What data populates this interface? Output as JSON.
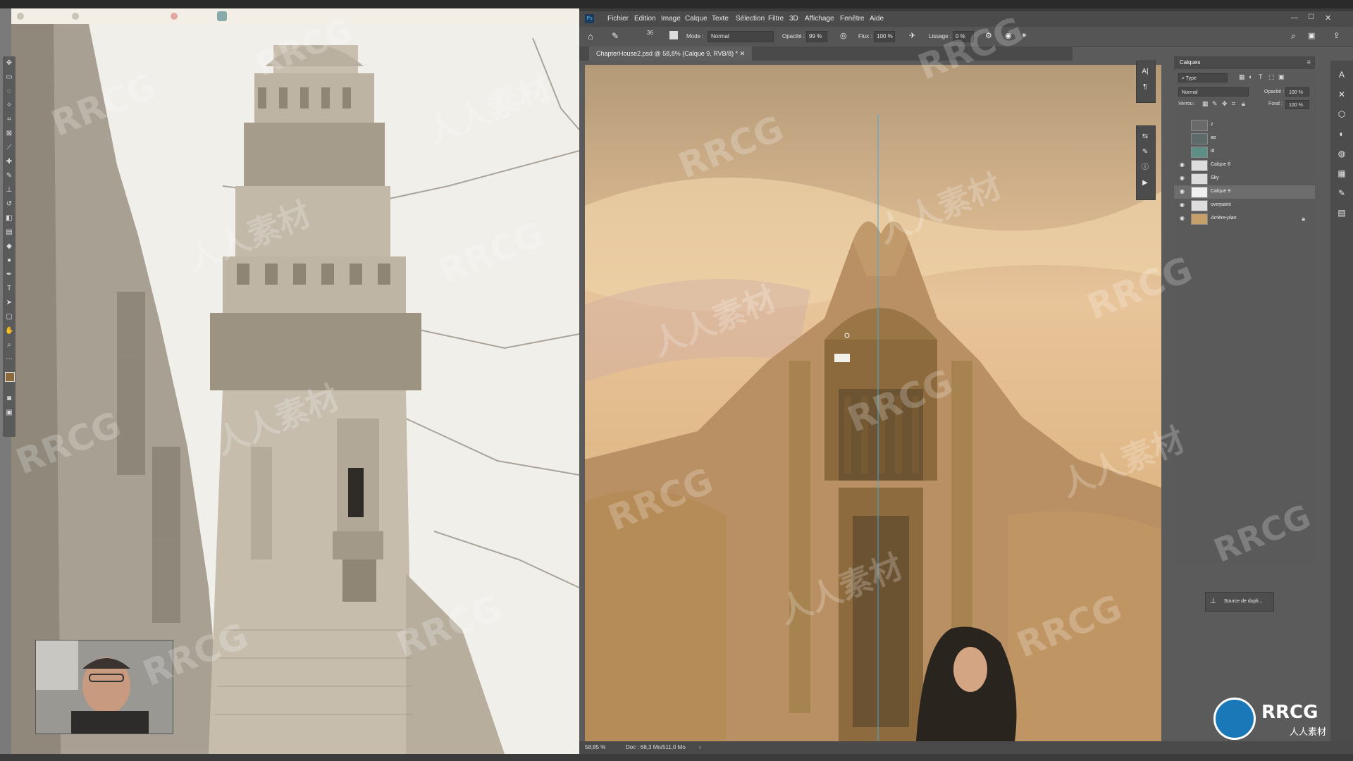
{
  "photoshop": {
    "menu": [
      "Fichier",
      "Edition",
      "Image",
      "Calque",
      "Texte",
      "Sélection",
      "Filtre",
      "3D",
      "Affichage",
      "Fenêtre",
      "Aide"
    ],
    "options": {
      "size": "36",
      "mode_label": "Mode :",
      "mode_value": "Normal",
      "opacity_label": "Opacité :",
      "opacity_value": "99 %",
      "flow_label": "Flux :",
      "flow_value": "100 %",
      "smoothing_label": "Lissage :",
      "smoothing_value": "0 %"
    },
    "document_tab": "ChapterHouse2.psd @ 58,8% (Calque 9, RVB/8) *",
    "status": {
      "zoom": "58,85 %",
      "doc": "Doc : 68,3 Mo/511,0 Mo"
    }
  },
  "layers_panel": {
    "title": "Calques",
    "filter": "Type",
    "blend_mode": "Normal",
    "opacity_label": "Opacité :",
    "opacity_value": "100 %",
    "lock_label": "Verrou :",
    "fill_label": "Fond :",
    "fill_value": "100 %",
    "layers": [
      {
        "name": "z",
        "visible": false,
        "selected": false
      },
      {
        "name": "ae",
        "visible": false,
        "selected": false
      },
      {
        "name": "id",
        "visible": false,
        "selected": false
      },
      {
        "name": "Calque 8",
        "visible": true,
        "selected": false
      },
      {
        "name": "Sky",
        "visible": true,
        "selected": false
      },
      {
        "name": "Calque 9",
        "visible": true,
        "selected": true
      },
      {
        "name": "overpaint",
        "visible": true,
        "selected": false
      },
      {
        "name": "Arrière-plan",
        "visible": true,
        "selected": false,
        "locked": true
      }
    ]
  },
  "clone_source": {
    "label": "Source de dupli..."
  },
  "watermarks": {
    "rrcg": "RRCG",
    "cn": "人人素材"
  },
  "logo": {
    "text": "RRCG",
    "sub": "人人素材"
  }
}
